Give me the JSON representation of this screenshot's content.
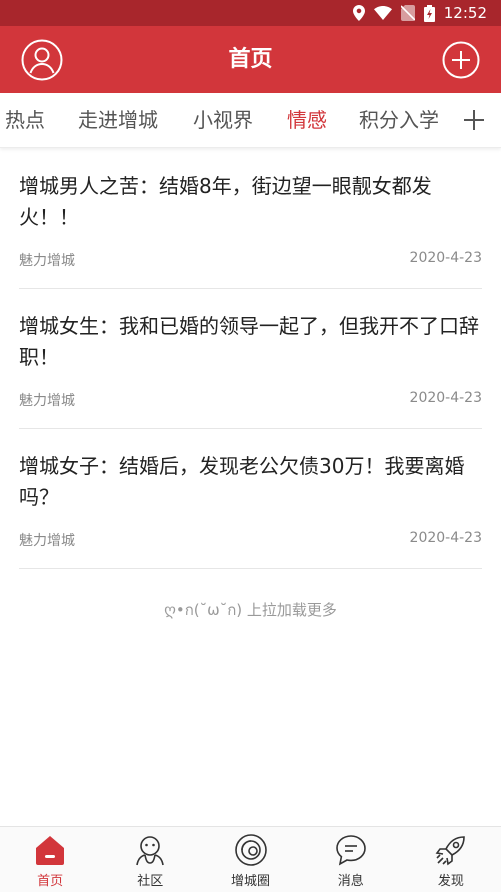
{
  "status_bar": {
    "time": "12:52"
  },
  "header": {
    "title": "首页"
  },
  "tabs": [
    {
      "label": "热点"
    },
    {
      "label": "走进增城"
    },
    {
      "label": "小视界"
    },
    {
      "label": "情感",
      "active": true
    },
    {
      "label": "积分入学"
    }
  ],
  "articles": [
    {
      "title": "增城男人之苦：结婚8年，街边望一眼靓女都发火！！",
      "source": "魅力增城",
      "date": "2020-4-23"
    },
    {
      "title": "增城女生：我和已婚的领导一起了，但我开不了口辞职！",
      "source": "魅力增城",
      "date": "2020-4-23"
    },
    {
      "title": "增城女子：结婚后，发现老公欠债30万！我要离婚吗？",
      "source": "魅力增城",
      "date": "2020-4-23"
    }
  ],
  "load_more": "ღ•ก(˘ω˘ก) 上拉加载更多",
  "bottom_nav": [
    {
      "label": "首页",
      "icon": "home-icon",
      "active": true
    },
    {
      "label": "社区",
      "icon": "community-icon"
    },
    {
      "label": "增城圈",
      "icon": "circle-icon"
    },
    {
      "label": "消息",
      "icon": "message-icon"
    },
    {
      "label": "发现",
      "icon": "rocket-icon"
    }
  ],
  "colors": {
    "accent": "#d2363b",
    "status_bar": "#a8262c",
    "text": "#222222",
    "muted": "#8a8a8a"
  }
}
